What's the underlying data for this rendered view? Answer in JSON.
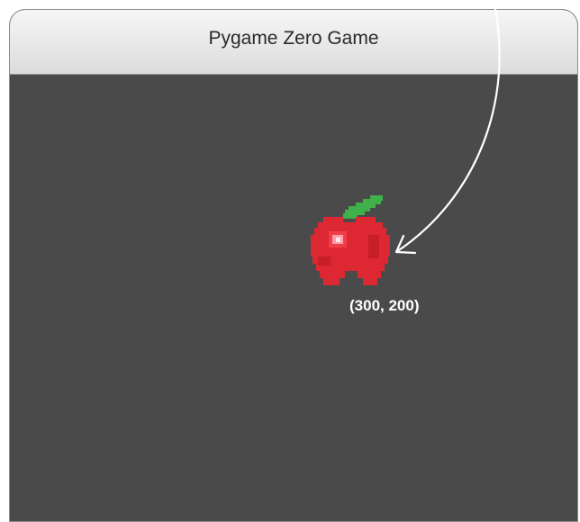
{
  "window": {
    "title": "Pygame Zero Game"
  },
  "game": {
    "background_color": "#4a4a4a",
    "sprite": {
      "name": "apple-icon",
      "position_label": "(300, 200)"
    }
  },
  "colors": {
    "apple_red": "#dd2833",
    "apple_dark": "#c81e29",
    "leaf_green": "#3fb04a",
    "highlight": "#ff9fa8",
    "arrow": "#ffffff"
  }
}
